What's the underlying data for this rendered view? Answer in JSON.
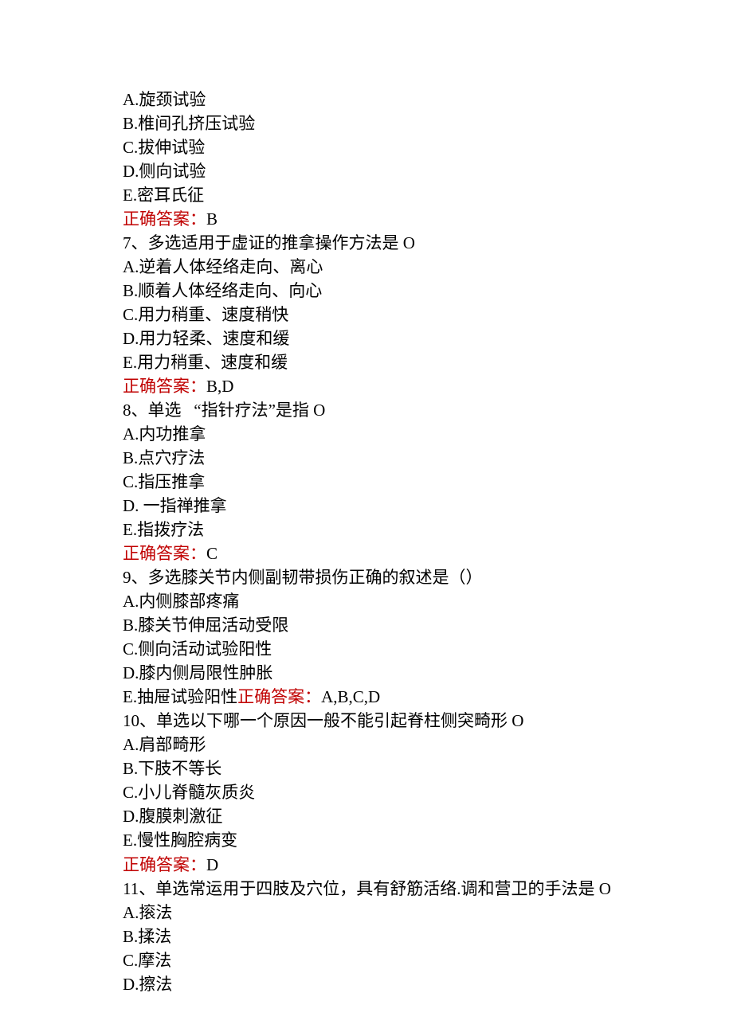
{
  "q6_tail": {
    "options": {
      "a": "A.旋颈试验",
      "b": "B.椎间孔挤压试验",
      "c": "C.拔伸试验",
      "d": "D.侧向试验",
      "e": "E.密耳氏征"
    },
    "answer_label": "正确答案：",
    "answer_value": "B"
  },
  "q7": {
    "stem": "7、多选适用于虚证的推拿操作方法是 O",
    "options": {
      "a": "A.逆着人体经络走向、离心",
      "b": "B.顺着人体经络走向、向心",
      "c": "C.用力稍重、速度稍快",
      "d": "D.用力轻柔、速度和缓",
      "e": "E.用力稍重、速度和缓"
    },
    "answer_label": "正确答案：",
    "answer_value": "B,D"
  },
  "q8": {
    "stem": "8、单选   “指针疗法”是指 O",
    "options": {
      "a": "A.内功推拿",
      "b": "B.点穴疗法",
      "c": "C.指压推拿",
      "d": "D. 一指禅推拿",
      "e": "E.指拨疗法"
    },
    "answer_label": "正确答案：",
    "answer_value": "C"
  },
  "q9": {
    "stem": "9、多选膝关节内侧副韧带损伤正确的叙述是（）",
    "options": {
      "a": "A.内侧膝部疼痛",
      "b": "B.膝关节伸屈活动受限",
      "c": "C.侧向活动试验阳性",
      "d": "D.膝内侧局限性肿胀",
      "e_prefix": "E.抽屉试验阳性"
    },
    "answer_label": "正确答案：",
    "answer_value": "A,B,C,D"
  },
  "q10": {
    "stem": "10、单选以下哪一个原因一般不能引起脊柱侧突畸形 O",
    "options": {
      "a": "A.肩部畸形",
      "b": "B.下肢不等长",
      "c": "C.小儿脊髓灰质炎",
      "d": "D.腹膜刺激征",
      "e": "E.慢性胸腔病变"
    },
    "answer_label": "正确答案：",
    "answer_value": "D"
  },
  "q11": {
    "stem": "11、单选常运用于四肢及穴位，具有舒筋活络.调和营卫的手法是 O",
    "options": {
      "a": "A.㨰法",
      "b": "B.揉法",
      "c": "C.摩法",
      "d": "D.擦法"
    }
  }
}
